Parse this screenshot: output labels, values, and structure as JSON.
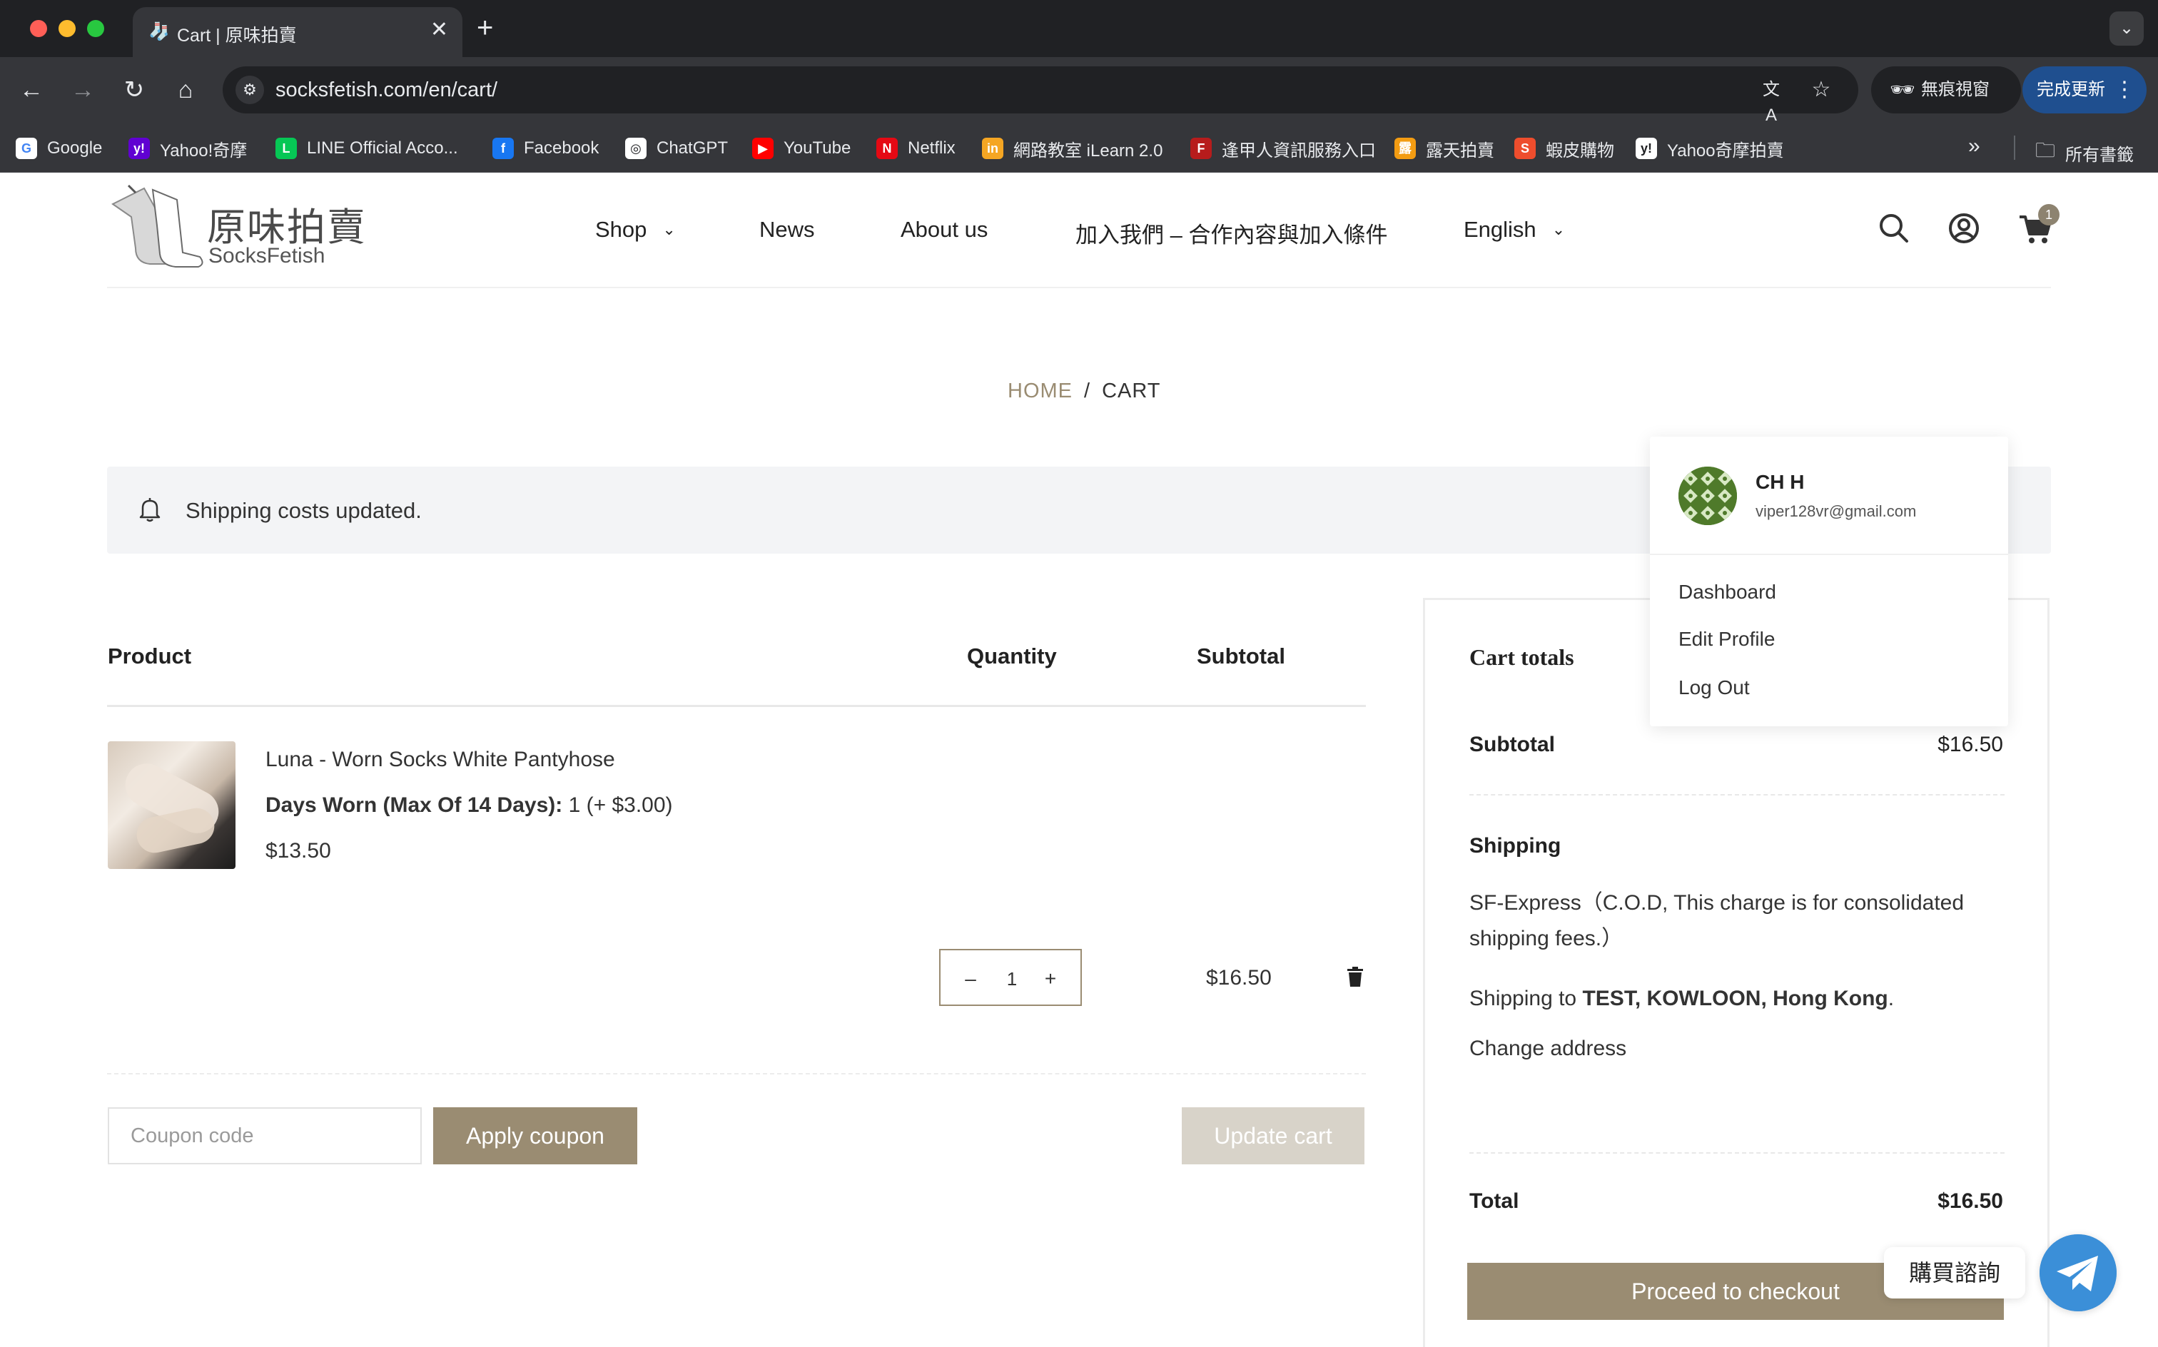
{
  "browser": {
    "tab_title": "Cart | 原味拍賣",
    "url": "socksfetish.com/en/cart/",
    "incognito_label": "無痕視窗",
    "update_label": "完成更新",
    "bookmarks": [
      {
        "label": "Google",
        "icon": "google-icon",
        "color": "#ffffff"
      },
      {
        "label": "Yahoo!奇摩",
        "icon": "yahoo-icon",
        "color": "#6001d2"
      },
      {
        "label": "LINE Official Acco...",
        "icon": "line-icon",
        "color": "#06c755"
      },
      {
        "label": "Facebook",
        "icon": "facebook-icon",
        "color": "#1877f2"
      },
      {
        "label": "ChatGPT",
        "icon": "chatgpt-icon",
        "color": "#ffffff"
      },
      {
        "label": "YouTube",
        "icon": "youtube-icon",
        "color": "#ff0000"
      },
      {
        "label": "Netflix",
        "icon": "netflix-icon",
        "color": "#e50914"
      },
      {
        "label": "網路教室 iLearn 2.0",
        "icon": "ilearn-icon",
        "color": "#f5a623"
      },
      {
        "label": "逢甲人資訊服務入口",
        "icon": "fcu-icon",
        "color": "#b71c1c"
      },
      {
        "label": "露天拍賣",
        "icon": "ruten-icon",
        "color": "#f39c12"
      },
      {
        "label": "蝦皮購物",
        "icon": "shopee-icon",
        "color": "#ee4d2d"
      },
      {
        "label": "Yahoo奇摩拍賣",
        "icon": "yahoo-auction-icon",
        "color": "#ffffff"
      }
    ],
    "all_bookmarks_label": "所有書籤"
  },
  "site": {
    "logo_cn": "原味拍賣",
    "logo_en": "SocksFetish",
    "nav": {
      "shop": "Shop",
      "news": "News",
      "about": "About us",
      "join": "加入我們 – 合作內容與加入條件",
      "language": "English"
    },
    "cart_count": "1",
    "breadcrumb": {
      "home": "HOME",
      "separator": "/",
      "current": "CART"
    },
    "notice": "Shipping costs updated."
  },
  "cart": {
    "headers": {
      "product": "Product",
      "quantity": "Quantity",
      "subtotal": "Subtotal"
    },
    "item": {
      "name": "Luna - Worn Socks White Pantyhose",
      "meta_label": "Days Worn (Max Of 14 Days):",
      "meta_value": "1 (+ $3.00)",
      "price": "$13.50",
      "quantity": "1",
      "minus": "–",
      "plus": "+",
      "subtotal": "$16.50"
    },
    "coupon_placeholder": "Coupon code",
    "apply_coupon": "Apply coupon",
    "update_cart": "Update cart"
  },
  "totals": {
    "title": "Cart totals",
    "subtotal_label": "Subtotal",
    "subtotal_value": "$16.50",
    "shipping_label": "Shipping",
    "shipping_method": "SF-Express（C.O.D, This charge is for consolidated shipping fees.）",
    "shipping_to_prefix": "Shipping to",
    "shipping_to_address": "TEST, KOWLOON, Hong Kong",
    "shipping_to_suffix": ".",
    "change_address": "Change address",
    "total_label": "Total",
    "total_value": "$16.50",
    "checkout": "Proceed to checkout"
  },
  "account_menu": {
    "name": "CH H",
    "email": "viper128vr@gmail.com",
    "items": [
      "Dashboard",
      "Edit Profile",
      "Log Out"
    ]
  },
  "chat": {
    "label": "購買諮詢"
  },
  "colors": {
    "accent": "#9a8c72",
    "accent_light": "#d8d3c9",
    "notice_bg": "#f3f4f6",
    "chat_blue": "#3b8fd8"
  }
}
